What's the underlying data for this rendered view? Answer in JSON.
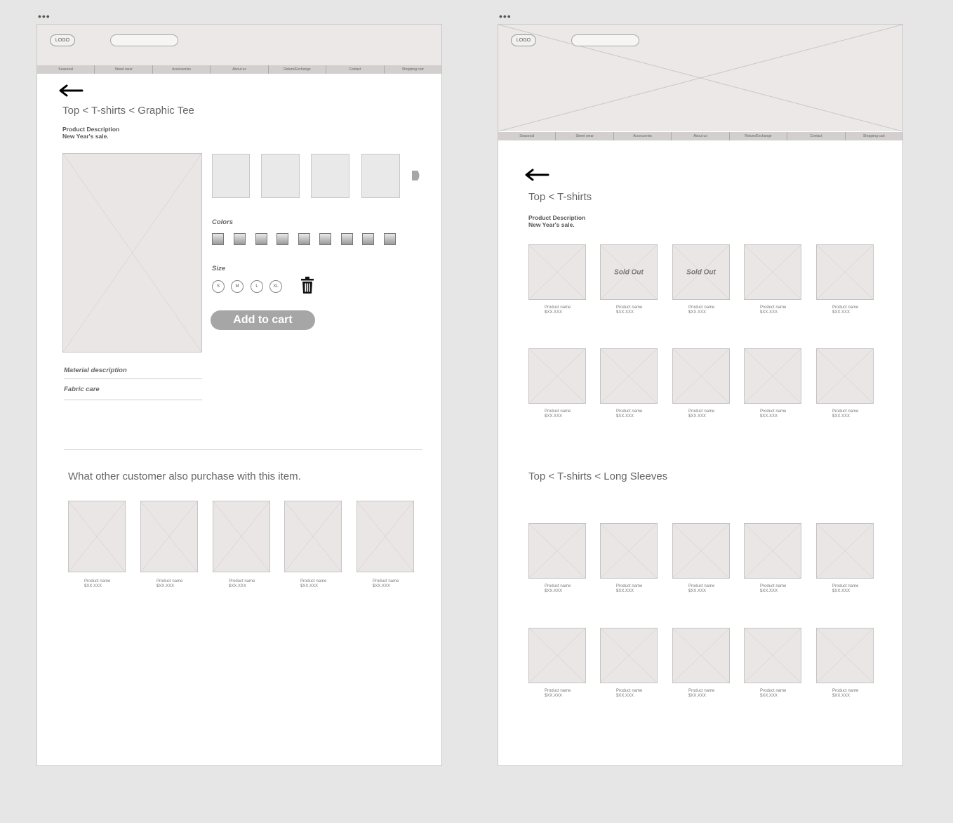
{
  "pages": {
    "detail": {
      "menu_dots": "•••",
      "logo": "LOGO",
      "nav": [
        "Seasonal",
        "Street wear",
        "Accessories",
        "About us",
        "Return/Exchange",
        "Contact",
        "Shopping cart"
      ],
      "breadcrumb": "Top < T-shirts < Graphic Tee",
      "description": {
        "title": "Product Description",
        "subtitle": "New Year's sale."
      },
      "colors_label": "Colors",
      "colors_count": 9,
      "size_label": "Size",
      "sizes": [
        "S",
        "M",
        "L",
        "XL"
      ],
      "add_to_cart": "Add to cart",
      "accordion": [
        "Material description",
        "Fabric care"
      ],
      "related_title": "What other customer also purchase with this item.",
      "related_products": [
        {
          "name": "Product name",
          "price": "$XX.XXX"
        },
        {
          "name": "Product name",
          "price": "$XX.XXX"
        },
        {
          "name": "Product name",
          "price": "$XX.XXX"
        },
        {
          "name": "Product name",
          "price": "$XX.XXX"
        },
        {
          "name": "Product name",
          "price": "$XX.XXX"
        }
      ]
    },
    "listing": {
      "menu_dots": "•••",
      "logo": "LOGO",
      "nav": [
        "Seasonal",
        "Street wear",
        "Accessories",
        "About us",
        "Return/Exchange",
        "Contact",
        "Shopping cart"
      ],
      "breadcrumb": "Top < T-shirts",
      "description": {
        "title": "Product Description",
        "subtitle": "New Year's sale."
      },
      "sold_out_label": "Sold Out",
      "section2_title": "Top < T-shirts < Long Sleeves",
      "grid1": [
        {
          "name": "Product name",
          "price": "$XX.XXX",
          "sold_out": false
        },
        {
          "name": "Product name",
          "price": "$XX.XXX",
          "sold_out": true
        },
        {
          "name": "Product name",
          "price": "$XX.XXX",
          "sold_out": true
        },
        {
          "name": "Product name",
          "price": "$XX.XXX",
          "sold_out": false
        },
        {
          "name": "Product name",
          "price": "$XX.XXX",
          "sold_out": false
        },
        {
          "name": "Product name",
          "price": "$XX.XXX",
          "sold_out": false
        },
        {
          "name": "Product name",
          "price": "$XX.XXX",
          "sold_out": false
        },
        {
          "name": "Product name",
          "price": "$XX.XXX",
          "sold_out": false
        },
        {
          "name": "Product name",
          "price": "$XX.XXX",
          "sold_out": false
        },
        {
          "name": "Product name",
          "price": "$XX.XXX",
          "sold_out": false
        }
      ],
      "grid2": [
        {
          "name": "Product name",
          "price": "$XX.XXX"
        },
        {
          "name": "Product name",
          "price": "$XX.XXX"
        },
        {
          "name": "Product name",
          "price": "$XX.XXX"
        },
        {
          "name": "Product name",
          "price": "$XX.XXX"
        },
        {
          "name": "Product name",
          "price": "$XX.XXX"
        },
        {
          "name": "Product name",
          "price": "$XX.XXX"
        },
        {
          "name": "Product name",
          "price": "$XX.XXX"
        },
        {
          "name": "Product name",
          "price": "$XX.XXX"
        },
        {
          "name": "Product name",
          "price": "$XX.XXX"
        },
        {
          "name": "Product name",
          "price": "$XX.XXX"
        }
      ]
    }
  }
}
